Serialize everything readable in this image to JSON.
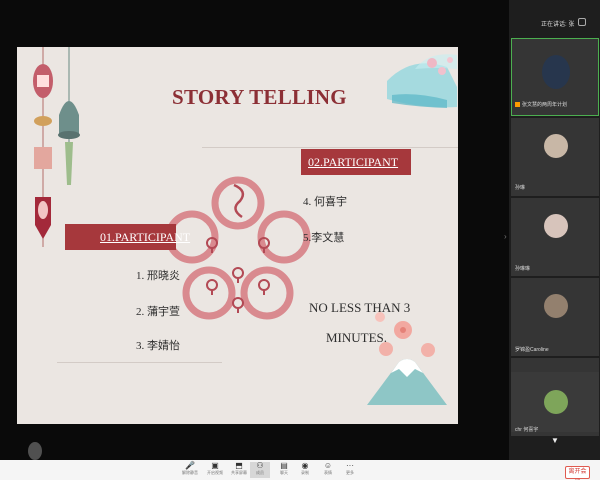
{
  "panel": {
    "hangup_label": "正在讲话: 张",
    "tiles": [
      {
        "label": "",
        "active": true,
        "speaking": false,
        "avatar_color": "#27364d"
      },
      {
        "label": "张文慧的两周年计划",
        "active": false,
        "speaking": true,
        "avatar_color": "#c8b7a6"
      },
      {
        "label": "孙琳",
        "active": false,
        "speaking": false,
        "avatar_color": "#d7c4bb"
      },
      {
        "label": "孙琳琳",
        "active": false,
        "speaking": false,
        "avatar_color": "#93806e"
      },
      {
        "label": "罗锦盈Caroline",
        "active": false,
        "speaking": false,
        "avatar_color": "#c8c8c8"
      },
      {
        "label": "chr 何喜宇",
        "active": false,
        "speaking": false,
        "avatar_color": "#7ea55a"
      }
    ]
  },
  "slide": {
    "title": "STORY TELLING",
    "participant1": {
      "heading": "01.PARTICIPANT",
      "names": [
        "1. 邢晓炎",
        "2. 蒲宇萱",
        "3. 李婧怡"
      ]
    },
    "participant2": {
      "heading": "02.PARTICIPANT",
      "names": [
        "4. 何喜宇",
        "5.李文慧"
      ]
    },
    "note_line1": "NO  LESS THAN 3",
    "note_line2": "MINUTES.",
    "accent_color": "#a6383c"
  },
  "toolbar": {
    "buttons": [
      {
        "icon": "microphone-icon",
        "label": "解除静音"
      },
      {
        "icon": "camera-icon",
        "label": "开启视频"
      },
      {
        "icon": "share-icon",
        "label": "共享屏幕"
      },
      {
        "icon": "people-icon",
        "label": "成员"
      },
      {
        "icon": "chat-icon",
        "label": "聊天"
      },
      {
        "icon": "record-icon",
        "label": "录制"
      },
      {
        "icon": "emoji-icon",
        "label": "表情"
      },
      {
        "icon": "more-icon",
        "label": "更多"
      }
    ],
    "leave_label": "离开会议"
  }
}
